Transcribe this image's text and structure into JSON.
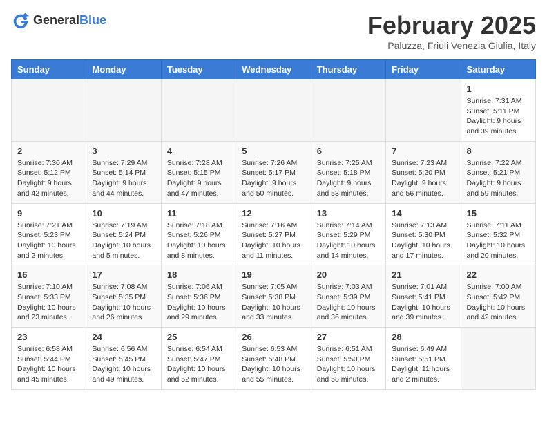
{
  "header": {
    "logo_general": "General",
    "logo_blue": "Blue",
    "title": "February 2025",
    "subtitle": "Paluzza, Friuli Venezia Giulia, Italy"
  },
  "days_of_week": [
    "Sunday",
    "Monday",
    "Tuesday",
    "Wednesday",
    "Thursday",
    "Friday",
    "Saturday"
  ],
  "weeks": [
    [
      {
        "day": "",
        "info": ""
      },
      {
        "day": "",
        "info": ""
      },
      {
        "day": "",
        "info": ""
      },
      {
        "day": "",
        "info": ""
      },
      {
        "day": "",
        "info": ""
      },
      {
        "day": "",
        "info": ""
      },
      {
        "day": "1",
        "info": "Sunrise: 7:31 AM\nSunset: 5:11 PM\nDaylight: 9 hours and 39 minutes."
      }
    ],
    [
      {
        "day": "2",
        "info": "Sunrise: 7:30 AM\nSunset: 5:12 PM\nDaylight: 9 hours and 42 minutes."
      },
      {
        "day": "3",
        "info": "Sunrise: 7:29 AM\nSunset: 5:14 PM\nDaylight: 9 hours and 44 minutes."
      },
      {
        "day": "4",
        "info": "Sunrise: 7:28 AM\nSunset: 5:15 PM\nDaylight: 9 hours and 47 minutes."
      },
      {
        "day": "5",
        "info": "Sunrise: 7:26 AM\nSunset: 5:17 PM\nDaylight: 9 hours and 50 minutes."
      },
      {
        "day": "6",
        "info": "Sunrise: 7:25 AM\nSunset: 5:18 PM\nDaylight: 9 hours and 53 minutes."
      },
      {
        "day": "7",
        "info": "Sunrise: 7:23 AM\nSunset: 5:20 PM\nDaylight: 9 hours and 56 minutes."
      },
      {
        "day": "8",
        "info": "Sunrise: 7:22 AM\nSunset: 5:21 PM\nDaylight: 9 hours and 59 minutes."
      }
    ],
    [
      {
        "day": "9",
        "info": "Sunrise: 7:21 AM\nSunset: 5:23 PM\nDaylight: 10 hours and 2 minutes."
      },
      {
        "day": "10",
        "info": "Sunrise: 7:19 AM\nSunset: 5:24 PM\nDaylight: 10 hours and 5 minutes."
      },
      {
        "day": "11",
        "info": "Sunrise: 7:18 AM\nSunset: 5:26 PM\nDaylight: 10 hours and 8 minutes."
      },
      {
        "day": "12",
        "info": "Sunrise: 7:16 AM\nSunset: 5:27 PM\nDaylight: 10 hours and 11 minutes."
      },
      {
        "day": "13",
        "info": "Sunrise: 7:14 AM\nSunset: 5:29 PM\nDaylight: 10 hours and 14 minutes."
      },
      {
        "day": "14",
        "info": "Sunrise: 7:13 AM\nSunset: 5:30 PM\nDaylight: 10 hours and 17 minutes."
      },
      {
        "day": "15",
        "info": "Sunrise: 7:11 AM\nSunset: 5:32 PM\nDaylight: 10 hours and 20 minutes."
      }
    ],
    [
      {
        "day": "16",
        "info": "Sunrise: 7:10 AM\nSunset: 5:33 PM\nDaylight: 10 hours and 23 minutes."
      },
      {
        "day": "17",
        "info": "Sunrise: 7:08 AM\nSunset: 5:35 PM\nDaylight: 10 hours and 26 minutes."
      },
      {
        "day": "18",
        "info": "Sunrise: 7:06 AM\nSunset: 5:36 PM\nDaylight: 10 hours and 29 minutes."
      },
      {
        "day": "19",
        "info": "Sunrise: 7:05 AM\nSunset: 5:38 PM\nDaylight: 10 hours and 33 minutes."
      },
      {
        "day": "20",
        "info": "Sunrise: 7:03 AM\nSunset: 5:39 PM\nDaylight: 10 hours and 36 minutes."
      },
      {
        "day": "21",
        "info": "Sunrise: 7:01 AM\nSunset: 5:41 PM\nDaylight: 10 hours and 39 minutes."
      },
      {
        "day": "22",
        "info": "Sunrise: 7:00 AM\nSunset: 5:42 PM\nDaylight: 10 hours and 42 minutes."
      }
    ],
    [
      {
        "day": "23",
        "info": "Sunrise: 6:58 AM\nSunset: 5:44 PM\nDaylight: 10 hours and 45 minutes."
      },
      {
        "day": "24",
        "info": "Sunrise: 6:56 AM\nSunset: 5:45 PM\nDaylight: 10 hours and 49 minutes."
      },
      {
        "day": "25",
        "info": "Sunrise: 6:54 AM\nSunset: 5:47 PM\nDaylight: 10 hours and 52 minutes."
      },
      {
        "day": "26",
        "info": "Sunrise: 6:53 AM\nSunset: 5:48 PM\nDaylight: 10 hours and 55 minutes."
      },
      {
        "day": "27",
        "info": "Sunrise: 6:51 AM\nSunset: 5:50 PM\nDaylight: 10 hours and 58 minutes."
      },
      {
        "day": "28",
        "info": "Sunrise: 6:49 AM\nSunset: 5:51 PM\nDaylight: 11 hours and 2 minutes."
      },
      {
        "day": "",
        "info": ""
      }
    ]
  ]
}
